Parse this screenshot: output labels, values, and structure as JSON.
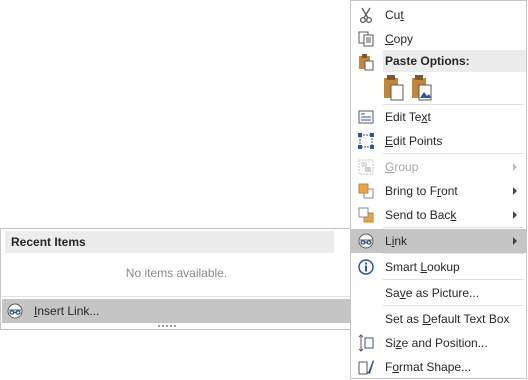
{
  "context_menu": {
    "cut": {
      "pre": "Cu",
      "key": "t",
      "post": "",
      "icon": "scissors-icon"
    },
    "copy": {
      "pre": "",
      "key": "C",
      "post": "opy",
      "icon": "copy-icon"
    },
    "paste_options_label": "Paste Options:",
    "paste_buttons": [
      "paste-keep-formatting-icon",
      "paste-picture-icon"
    ],
    "edit_text": {
      "pre": "Edit Te",
      "key": "x",
      "post": "t",
      "icon": "edit-text-icon"
    },
    "edit_points": {
      "pre": "",
      "key": "E",
      "post": "dit Points",
      "icon": "edit-points-icon"
    },
    "group": {
      "pre": "",
      "key": "G",
      "post": "roup",
      "icon": "group-icon",
      "disabled": true
    },
    "bring_to_front": {
      "pre": "Bring to F",
      "key": "r",
      "post": "ont",
      "icon": "bring-to-front-icon"
    },
    "send_to_back": {
      "pre": "Send to Bac",
      "key": "k",
      "post": "",
      "icon": "send-to-back-icon"
    },
    "link": {
      "pre": "L",
      "key": "i",
      "post": "nk",
      "icon": "link-icon"
    },
    "smart_lookup": {
      "pre": "Smart ",
      "key": "L",
      "post": "ookup",
      "icon": "smart-lookup-icon"
    },
    "save_as_picture": {
      "pre": "Sa",
      "key": "v",
      "post": "e as Picture...",
      "icon": ""
    },
    "set_default_text_box": {
      "pre": "Set as ",
      "key": "D",
      "post": "efault Text Box",
      "icon": ""
    },
    "size_position": {
      "pre": "Si",
      "key": "z",
      "post": "e and Position...",
      "icon": "size-position-icon"
    },
    "format_shape": {
      "pre": "F",
      "key": "o",
      "post": "rmat Shape...",
      "icon": "format-shape-icon"
    }
  },
  "link_submenu": {
    "header": "Recent Items",
    "empty_text": "No items available.",
    "insert_link": {
      "pre": "",
      "key": "I",
      "post": "nsert Link...",
      "icon": "insert-link-icon"
    }
  },
  "colors": {
    "hover": "#c5c5c5",
    "header_bg": "#ececec",
    "accent_blue": "#2b579a",
    "paste_orange": "#c0873c"
  }
}
